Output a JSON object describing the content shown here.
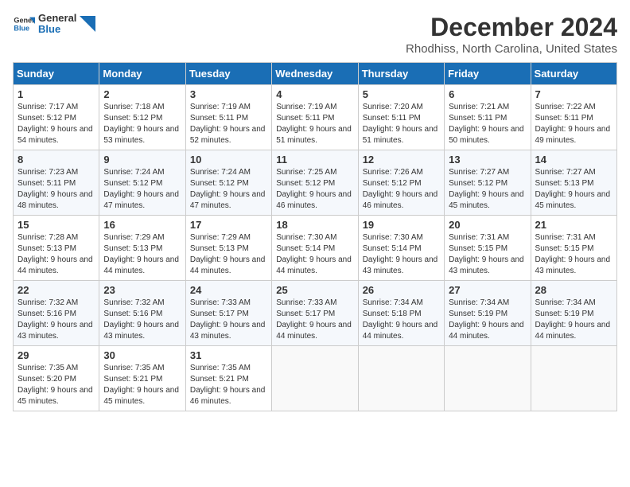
{
  "logo": {
    "text_general": "General",
    "text_blue": "Blue"
  },
  "header": {
    "month": "December 2024",
    "location": "Rhodhiss, North Carolina, United States"
  },
  "weekdays": [
    "Sunday",
    "Monday",
    "Tuesday",
    "Wednesday",
    "Thursday",
    "Friday",
    "Saturday"
  ],
  "weeks": [
    [
      {
        "day": "1",
        "sunrise": "7:17 AM",
        "sunset": "5:12 PM",
        "daylight": "9 hours and 54 minutes."
      },
      {
        "day": "2",
        "sunrise": "7:18 AM",
        "sunset": "5:12 PM",
        "daylight": "9 hours and 53 minutes."
      },
      {
        "day": "3",
        "sunrise": "7:19 AM",
        "sunset": "5:11 PM",
        "daylight": "9 hours and 52 minutes."
      },
      {
        "day": "4",
        "sunrise": "7:19 AM",
        "sunset": "5:11 PM",
        "daylight": "9 hours and 51 minutes."
      },
      {
        "day": "5",
        "sunrise": "7:20 AM",
        "sunset": "5:11 PM",
        "daylight": "9 hours and 51 minutes."
      },
      {
        "day": "6",
        "sunrise": "7:21 AM",
        "sunset": "5:11 PM",
        "daylight": "9 hours and 50 minutes."
      },
      {
        "day": "7",
        "sunrise": "7:22 AM",
        "sunset": "5:11 PM",
        "daylight": "9 hours and 49 minutes."
      }
    ],
    [
      {
        "day": "8",
        "sunrise": "7:23 AM",
        "sunset": "5:11 PM",
        "daylight": "9 hours and 48 minutes."
      },
      {
        "day": "9",
        "sunrise": "7:24 AM",
        "sunset": "5:12 PM",
        "daylight": "9 hours and 47 minutes."
      },
      {
        "day": "10",
        "sunrise": "7:24 AM",
        "sunset": "5:12 PM",
        "daylight": "9 hours and 47 minutes."
      },
      {
        "day": "11",
        "sunrise": "7:25 AM",
        "sunset": "5:12 PM",
        "daylight": "9 hours and 46 minutes."
      },
      {
        "day": "12",
        "sunrise": "7:26 AM",
        "sunset": "5:12 PM",
        "daylight": "9 hours and 46 minutes."
      },
      {
        "day": "13",
        "sunrise": "7:27 AM",
        "sunset": "5:12 PM",
        "daylight": "9 hours and 45 minutes."
      },
      {
        "day": "14",
        "sunrise": "7:27 AM",
        "sunset": "5:13 PM",
        "daylight": "9 hours and 45 minutes."
      }
    ],
    [
      {
        "day": "15",
        "sunrise": "7:28 AM",
        "sunset": "5:13 PM",
        "daylight": "9 hours and 44 minutes."
      },
      {
        "day": "16",
        "sunrise": "7:29 AM",
        "sunset": "5:13 PM",
        "daylight": "9 hours and 44 minutes."
      },
      {
        "day": "17",
        "sunrise": "7:29 AM",
        "sunset": "5:13 PM",
        "daylight": "9 hours and 44 minutes."
      },
      {
        "day": "18",
        "sunrise": "7:30 AM",
        "sunset": "5:14 PM",
        "daylight": "9 hours and 44 minutes."
      },
      {
        "day": "19",
        "sunrise": "7:30 AM",
        "sunset": "5:14 PM",
        "daylight": "9 hours and 43 minutes."
      },
      {
        "day": "20",
        "sunrise": "7:31 AM",
        "sunset": "5:15 PM",
        "daylight": "9 hours and 43 minutes."
      },
      {
        "day": "21",
        "sunrise": "7:31 AM",
        "sunset": "5:15 PM",
        "daylight": "9 hours and 43 minutes."
      }
    ],
    [
      {
        "day": "22",
        "sunrise": "7:32 AM",
        "sunset": "5:16 PM",
        "daylight": "9 hours and 43 minutes."
      },
      {
        "day": "23",
        "sunrise": "7:32 AM",
        "sunset": "5:16 PM",
        "daylight": "9 hours and 43 minutes."
      },
      {
        "day": "24",
        "sunrise": "7:33 AM",
        "sunset": "5:17 PM",
        "daylight": "9 hours and 43 minutes."
      },
      {
        "day": "25",
        "sunrise": "7:33 AM",
        "sunset": "5:17 PM",
        "daylight": "9 hours and 44 minutes."
      },
      {
        "day": "26",
        "sunrise": "7:34 AM",
        "sunset": "5:18 PM",
        "daylight": "9 hours and 44 minutes."
      },
      {
        "day": "27",
        "sunrise": "7:34 AM",
        "sunset": "5:19 PM",
        "daylight": "9 hours and 44 minutes."
      },
      {
        "day": "28",
        "sunrise": "7:34 AM",
        "sunset": "5:19 PM",
        "daylight": "9 hours and 44 minutes."
      }
    ],
    [
      {
        "day": "29",
        "sunrise": "7:35 AM",
        "sunset": "5:20 PM",
        "daylight": "9 hours and 45 minutes."
      },
      {
        "day": "30",
        "sunrise": "7:35 AM",
        "sunset": "5:21 PM",
        "daylight": "9 hours and 45 minutes."
      },
      {
        "day": "31",
        "sunrise": "7:35 AM",
        "sunset": "5:21 PM",
        "daylight": "9 hours and 46 minutes."
      },
      null,
      null,
      null,
      null
    ]
  ],
  "labels": {
    "sunrise": "Sunrise:",
    "sunset": "Sunset:",
    "daylight": "Daylight:"
  }
}
